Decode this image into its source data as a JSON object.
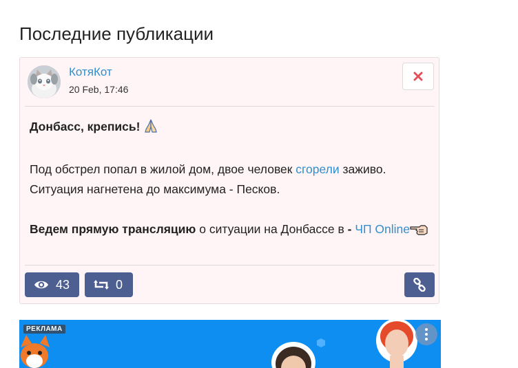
{
  "page": {
    "title": "Последние публикации"
  },
  "post": {
    "author": "КотяКот",
    "date": "20 Feb, 17:46",
    "headline": "Донбасс, крепись!",
    "line1_before": "Под обстрел попал в жилой дом, двое человек ",
    "line1_link": "сгорели",
    "line1_after": " заживо.",
    "line2": "Ситуация нагнетена до максимума - Песков.",
    "line3_bold": "Ведем прямую трансляцию",
    "line3_mid": " о ситуации на Донбассе в ",
    "line3_dash": "-",
    "line3_space": " ",
    "line3_link": "ЧП Online",
    "views": "43",
    "reposts": "0"
  },
  "ad": {
    "label": "РЕКЛАМА"
  },
  "colors": {
    "link": "#2f8fd0",
    "button_bg": "#4d5e91",
    "card_bg": "#fff5f6",
    "close_icon": "#e4505a",
    "ad_bg": "#0e8ef0"
  },
  "icons": {
    "close": "close-x-icon",
    "views": "eye-icon",
    "reposts": "repost-arrows-icon",
    "link": "chain-link-icon",
    "headline_emoji": "folded-hands-icon",
    "pointing_emoji": "pointing-left-hand-icon"
  }
}
